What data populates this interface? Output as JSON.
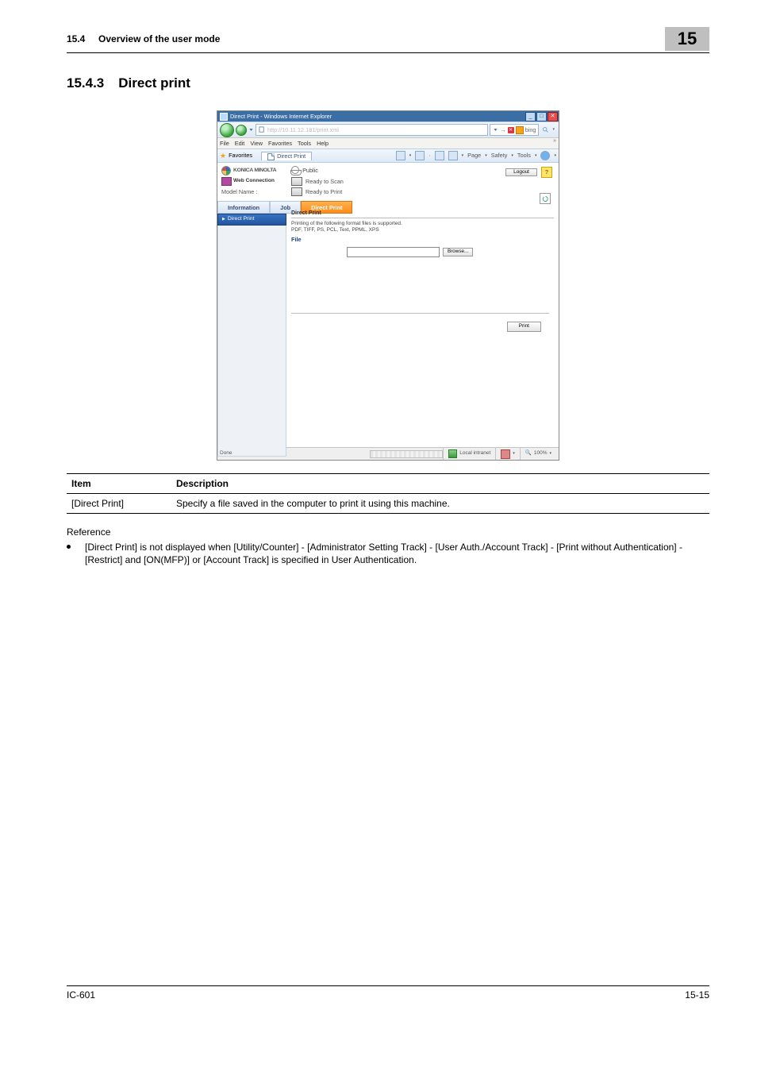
{
  "doc": {
    "section_number": "15.4",
    "section_title": "Overview of the user mode",
    "chapter_no": "15",
    "sub_number": "15.4.3",
    "sub_title": "Direct print",
    "table": {
      "head_item": "Item",
      "head_desc": "Description",
      "row1_item": "[Direct Print]",
      "row1_desc": "Specify a file saved in the computer to print it using this machine."
    },
    "reference_label": "Reference",
    "bullet1": "[Direct Print] is not displayed when [Utility/Counter] - [Administrator Setting Track] - [User Auth./Account Track] - [Print without Authentication] - [Restrict] and [ON(MFP)] or [Account Track] is specified in User Authentication.",
    "footer_left": "IC-601",
    "footer_right": "15-15"
  },
  "shot": {
    "titlebar": "Direct Print - Windows Internet Explorer",
    "addr_url": "http://10.11.12.181/print.xml",
    "addr_go_arrow": "→",
    "addr_x": "✕",
    "addr_bing": "bing",
    "menu": {
      "file": "File",
      "edit": "Edit",
      "view": "View",
      "fav": "Favorites",
      "tools": "Tools",
      "help": "Help"
    },
    "favbar": {
      "fav_label": "Favorites",
      "tab_label": "Direct Print",
      "page": "Page",
      "safety": "Safety",
      "tools": "Tools"
    },
    "brand": "KONICA MINOLTA",
    "webconn": "Web Connection",
    "modelname": "Model Name :",
    "public": "Public",
    "logout": "Logout",
    "status_ready_scan": "Ready to Scan",
    "status_ready_print": "Ready to Print",
    "tabs": {
      "info": "Information",
      "job": "Job",
      "dp": "Direct Print"
    },
    "side_head": "Direct Print",
    "dp_title": "Direct Print",
    "dp_desc_line1": "Printing of the following format files is supported.",
    "dp_desc_line2": "PDF, TIFF, PS, PCL, Text, PPML, XPS",
    "dp_file": "File",
    "browse": "Browse...",
    "print": "Print",
    "status_done": "Done",
    "zone": "Local intranet",
    "zoom": "100%"
  }
}
